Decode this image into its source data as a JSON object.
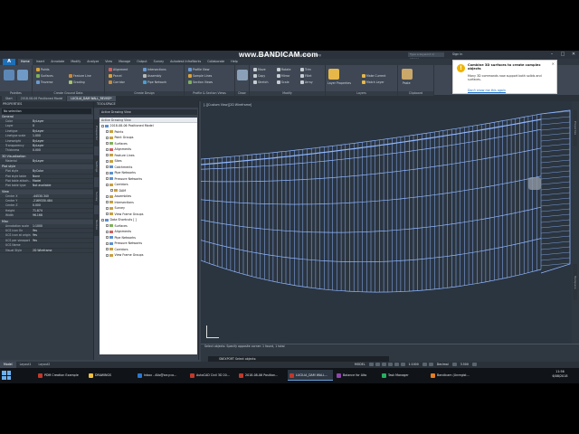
{
  "window": {
    "title": "Autodesk Civil 3D 2018   DRAWING1.dwg",
    "watermark": "www.BANDICAM.com",
    "search_placeholder": "Type a keyword or phrase",
    "user": "Sign In"
  },
  "app_tabs": [
    "Home",
    "Insert",
    "Annotate",
    "Modify",
    "Analyze",
    "View",
    "Manage",
    "Output",
    "Survey",
    "Autodesk InfraWorks",
    "Collaborate",
    "Help"
  ],
  "ribbon": {
    "palettes": {
      "label": "Palettes"
    },
    "ground": {
      "label": "Create Ground Data",
      "items": [
        "Points",
        "Surfaces",
        "Traverse",
        "Feature Line",
        "Grading"
      ]
    },
    "design": {
      "label": "Create Design",
      "items": [
        "Alignment",
        "Parcel",
        "Assembly",
        "Corridor",
        "Intersections",
        "Pipe Network"
      ]
    },
    "profile": {
      "label": "Profile & Section Views",
      "items": [
        "Profile View",
        "Sample Lines",
        "Section Views"
      ]
    },
    "draw": {
      "label": "Draw"
    },
    "modify": {
      "label": "Modify",
      "items": [
        "Move",
        "Rotate",
        "Trim",
        "Copy",
        "Mirror",
        "Fillet",
        "Stretch",
        "Scale",
        "Array"
      ]
    },
    "layers": {
      "label": "Layers",
      "items": [
        "Layer Properties",
        "Make Current",
        "Match Layer"
      ]
    },
    "clipboard": {
      "label": "Clipboard",
      "items": [
        "Paste"
      ]
    }
  },
  "doc_tabs": [
    "Start",
    "2018-08-06 Positioned Model",
    "LUCILIA_DAM WALL_REVISE*"
  ],
  "properties": {
    "title": "PROPERTIES",
    "selection": "No selection",
    "sections": [
      {
        "name": "General",
        "rows": [
          [
            "Color",
            "ByLayer"
          ],
          [
            "Layer",
            "0"
          ],
          [
            "Linetype",
            "ByLayer"
          ],
          [
            "Linetype scale",
            "1.000"
          ],
          [
            "Lineweight",
            "ByLayer"
          ],
          [
            "Transparency",
            "ByLayer"
          ],
          [
            "Thickness",
            "0.000"
          ]
        ]
      },
      {
        "name": "3D Visualization",
        "rows": [
          [
            "Material",
            "ByLayer"
          ]
        ]
      },
      {
        "name": "Plot style",
        "rows": [
          [
            "Plot style",
            "ByColor"
          ],
          [
            "Plot style table",
            "None"
          ],
          [
            "Plot table attach...",
            "Model"
          ],
          [
            "Plot table type",
            "Not available"
          ]
        ]
      },
      {
        "name": "View",
        "rows": [
          [
            "Center X",
            "-44530.340"
          ],
          [
            "Center Y",
            "-2169330.484"
          ],
          [
            "Center Z",
            "0.000"
          ],
          [
            "Height",
            "71.874"
          ],
          [
            "Width",
            "96.168"
          ]
        ]
      },
      {
        "name": "Misc",
        "rows": [
          [
            "Annotation scale",
            "1:1000"
          ],
          [
            "UCS icon On",
            "Yes"
          ],
          [
            "UCS icon at origin",
            "Yes"
          ],
          [
            "UCS per viewport",
            "Yes"
          ],
          [
            "UCS Name",
            ""
          ],
          [
            "Visual Style",
            "2D Wireframe"
          ]
        ]
      }
    ]
  },
  "toolspace": {
    "title": "TOOLSPACE",
    "active_view": "Active Drawing View",
    "tree": [
      {
        "label": "2018-08-06 Positioned Model",
        "level": 0,
        "color": "#5b8fd0"
      },
      {
        "label": "Points",
        "level": 1,
        "color": "#c8a040"
      },
      {
        "label": "Point Groups",
        "level": 1,
        "color": "#c8a040"
      },
      {
        "label": "Surfaces",
        "level": 1,
        "color": "#7fb05a"
      },
      {
        "label": "Alignments",
        "level": 1,
        "color": "#d06060"
      },
      {
        "label": "Feature Lines",
        "level": 1,
        "color": "#c8a040"
      },
      {
        "label": "Sites",
        "level": 1,
        "color": "#c8a040"
      },
      {
        "label": "Catchments",
        "level": 1,
        "color": "#5b8fd0"
      },
      {
        "label": "Pipe Networks",
        "level": 1,
        "color": "#5b8fd0"
      },
      {
        "label": "Pressure Networks",
        "level": 1,
        "color": "#5b8fd0"
      },
      {
        "label": "Corridors",
        "level": 1,
        "color": "#c8a040"
      },
      {
        "label": "DAM",
        "level": 2,
        "color": "#c8a040"
      },
      {
        "label": "Assemblies",
        "level": 1,
        "color": "#c8a040"
      },
      {
        "label": "Intersections",
        "level": 1,
        "color": "#c8a040"
      },
      {
        "label": "Survey",
        "level": 1,
        "color": "#c8a040"
      },
      {
        "label": "View Frame Groups",
        "level": 1,
        "color": "#c8a040"
      },
      {
        "label": "Data Shortcuts [ ]",
        "level": 0,
        "color": "#5b8fd0"
      },
      {
        "label": "Surfaces",
        "level": 1,
        "color": "#7fb05a"
      },
      {
        "label": "Alignments",
        "level": 1,
        "color": "#d06060"
      },
      {
        "label": "Pipe Networks",
        "level": 1,
        "color": "#5b8fd0"
      },
      {
        "label": "Pressure Networks",
        "level": 1,
        "color": "#5b8fd0"
      },
      {
        "label": "Corridors",
        "level": 1,
        "color": "#c8a040"
      },
      {
        "label": "View Frame Groups",
        "level": 1,
        "color": "#c8a040"
      }
    ],
    "side_tabs": [
      "Prospector",
      "Settings",
      "Survey",
      "Toolbox"
    ]
  },
  "viewport": {
    "label": "[-][Custom View][2D Wireframe]",
    "side_tabs": [
      "Properties",
      "Toolspace"
    ]
  },
  "notification": {
    "title": "Combine 3D surfaces to create complex objects",
    "body": "Many 3D commands now support both solids and surfaces.",
    "link": "Don't show me this again"
  },
  "command": {
    "history": "Select objects: Specify opposite corner: 1 found, 1 total",
    "prompt": "SNEXPORT Select objects:"
  },
  "layout_tabs": [
    "Model",
    "Layout1",
    "Layout2"
  ],
  "status": {
    "model": "MODEL",
    "scale": "1:1000",
    "units": "Decimal",
    "coords": "3.500"
  },
  "taskbar": {
    "items": [
      {
        "label": "PDM Creation Example",
        "color": "#c0392b"
      },
      {
        "label": "DRAWINGS",
        "color": "#f0c040"
      },
      {
        "label": "Inbox - Allo@arcy.co...",
        "color": "#2a78d0"
      },
      {
        "label": "AutoCAD Civil 3D 20...",
        "color": "#c0392b"
      },
      {
        "label": "2018-08-06 Position...",
        "color": "#c0392b"
      },
      {
        "label": "LUCILIA_DAM WALL...",
        "color": "#c0392b"
      },
      {
        "label": "Balance for Alto",
        "color": "#8e44ad"
      },
      {
        "label": "Task Manager",
        "color": "#27ae60"
      },
      {
        "label": "Bandicam (Unregist...",
        "color": "#e67e22"
      }
    ],
    "time": "11:56",
    "date": "6/08/2018"
  }
}
